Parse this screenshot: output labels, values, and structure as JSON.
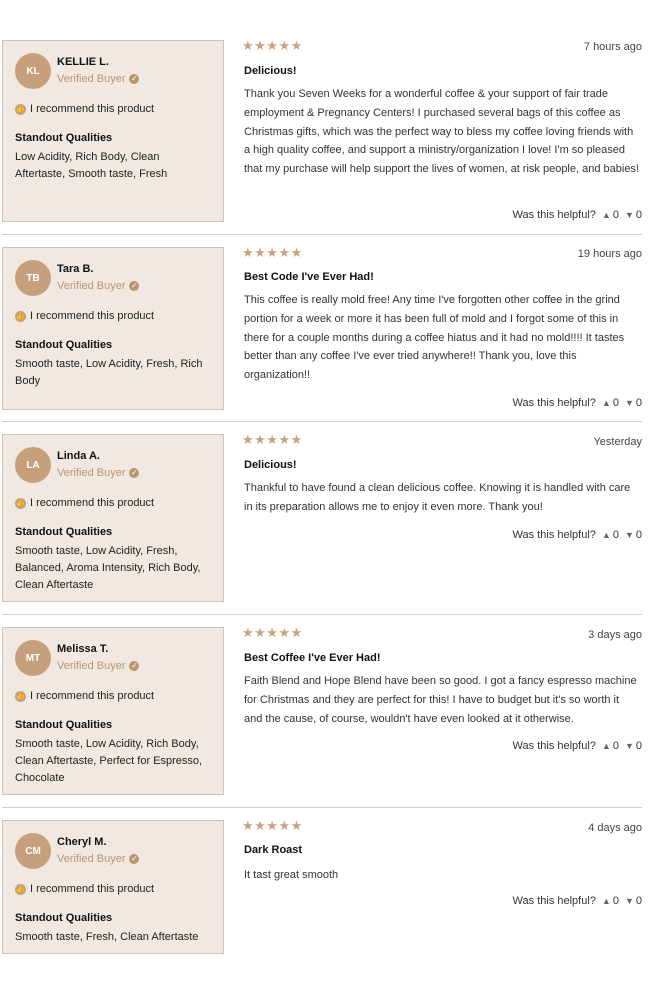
{
  "reviews": [
    {
      "initials": "KL",
      "name": "KELLIE L.",
      "verified": "Verified Buyer",
      "recommend": "I recommend this product",
      "standout_title": "Standout Qualities",
      "qualities": "Low Acidity, Rich Body, Clean Aftertaste, Smooth taste, Fresh",
      "stars": "★★★★★",
      "time": "7 hours ago",
      "title": "Delicious!",
      "body": "Thank you Seven Weeks for a wonderful coffee & your support of fair trade employment & Pregnancy Centers! I purchased several bags of this coffee as Christmas gifts, which was the perfect way to bless my coffee loving friends with a high quality coffee, and support a ministry/organization I love! I'm so pleased that my purchase will help support the lives of women, at risk people, and babies!",
      "helpful": "Was this helpful?",
      "up": "0",
      "down": "0"
    },
    {
      "initials": "TB",
      "name": "Tara B.",
      "verified": "Verified Buyer",
      "recommend": "I recommend this product",
      "standout_title": "Standout Qualities",
      "qualities": "Smooth taste, Low Acidity, Fresh, Rich Body",
      "stars": "★★★★★",
      "time": "19 hours ago",
      "title": "Best Code I've Ever Had!",
      "body": "This coffee is really mold free! Any time I've forgotten other coffee in the grind portion for a week or more it has been full of mold and I forgot some of this in there for a couple months during a coffee hiatus and it had no mold!!!! It tastes better than any coffee I've ever tried anywhere!! Thank you, love this organization!!",
      "helpful": "Was this helpful?",
      "up": "0",
      "down": "0"
    },
    {
      "initials": "LA",
      "name": "Linda A.",
      "verified": "Verified Buyer",
      "recommend": "I recommend this product",
      "standout_title": "Standout Qualities",
      "qualities": "Smooth taste, Low Acidity, Fresh, Balanced, Aroma Intensity, Rich Body, Clean Aftertaste",
      "stars": "★★★★★",
      "time": "Yesterday",
      "title": "Delicious!",
      "body": "Thankful to have found a clean delicious coffee. Knowing it is handled with care in its preparation allows me to enjoy it even more. Thank you!",
      "helpful": "Was this helpful?",
      "up": "0",
      "down": "0"
    },
    {
      "initials": "MT",
      "name": "Melissa T.",
      "verified": "Verified Buyer",
      "recommend": "I recommend this product",
      "standout_title": "Standout Qualities",
      "qualities": "Smooth taste, Low Acidity, Rich Body, Clean Aftertaste, Perfect for Espresso, Chocolate",
      "stars": "★★★★★",
      "time": "3 days ago",
      "title": "Best Coffee I've Ever Had!",
      "body": "Faith Blend and Hope Blend have been so good. I got a fancy espresso machine for Christmas and they are perfect for this! I have to budget but it's so worth it and the cause, of course, wouldn't have even looked at it otherwise.",
      "helpful": "Was this helpful?",
      "up": "0",
      "down": "0"
    },
    {
      "initials": "CM",
      "name": "Cheryl M.",
      "verified": "Verified Buyer",
      "recommend": "I recommend this product",
      "standout_title": "Standout Qualities",
      "qualities": "Smooth taste, Fresh, Clean Aftertaste",
      "stars": "★★★★★",
      "time": "4 days ago",
      "title": "Dark Roast",
      "body": "It tast great smooth",
      "helpful": "Was this helpful?",
      "up": "0",
      "down": "0"
    }
  ]
}
